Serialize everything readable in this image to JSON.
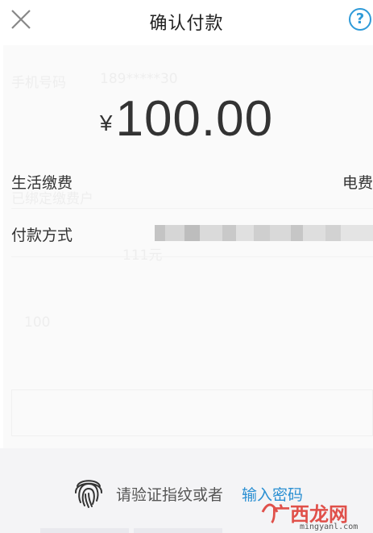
{
  "header": {
    "title": "确认付款",
    "help_label": "?"
  },
  "payment": {
    "currency": "¥",
    "amount": "100.00",
    "category_label": "生活缴费",
    "category_value": "电费",
    "method_label": "付款方式"
  },
  "ghost": {
    "phone_label": "手机号码",
    "phone_value": "189*****30",
    "hint_text": "已绑定缴费户",
    "small_1": "111元",
    "small_2": "100"
  },
  "verify": {
    "prompt": "请验证指纹或者",
    "password_link": "输入密码"
  },
  "watermark": {
    "cn": "广西龙网",
    "en": "mingyanl.com"
  },
  "colors": {
    "accent": "#2a8fd2",
    "watermark": "#e0504a"
  }
}
